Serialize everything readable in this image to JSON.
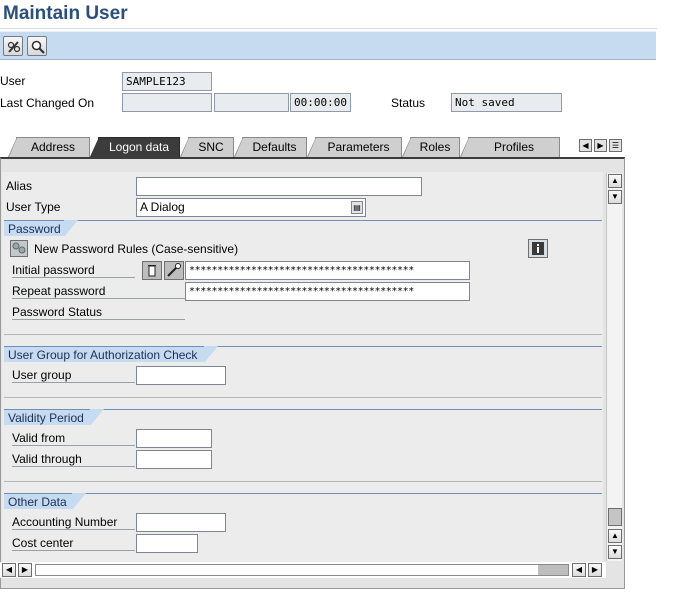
{
  "app": {
    "title": "Maintain User"
  },
  "toolbar": {
    "icons": [
      "pencil-glasses-icon",
      "magnifier-icon"
    ]
  },
  "header": {
    "user_label": "User",
    "user_value": "SAMPLE123",
    "last_changed_label": "Last Changed On",
    "last_changed_by": "",
    "last_changed_date": "",
    "last_changed_time": "00:00:00",
    "status_label": "Status",
    "status_value": "Not saved"
  },
  "tabs": [
    {
      "label": "Address",
      "active": false
    },
    {
      "label": "Logon data",
      "active": true
    },
    {
      "label": "SNC",
      "active": false
    },
    {
      "label": "Defaults",
      "active": false
    },
    {
      "label": "Parameters",
      "active": false
    },
    {
      "label": "Roles",
      "active": false
    },
    {
      "label": "Profiles",
      "active": false
    }
  ],
  "form": {
    "alias_label": "Alias",
    "alias_value": "",
    "user_type_label": "User Type",
    "user_type_value": "A Dialog",
    "password": {
      "group_title": "Password",
      "rules_text": "New Password Rules (Case-sensitive)",
      "initial_label": "Initial password",
      "initial_value": "****************************************",
      "repeat_label": "Repeat password",
      "repeat_value": "****************************************",
      "status_label": "Password Status"
    },
    "user_group": {
      "group_title": "User Group for Authorization Check",
      "label": "User group",
      "value": ""
    },
    "validity": {
      "group_title": "Validity Period",
      "from_label": "Valid from",
      "from_value": "",
      "through_label": "Valid through",
      "through_value": ""
    },
    "other": {
      "group_title": "Other Data",
      "accounting_label": "Accounting Number",
      "accounting_value": "",
      "cost_center_label": "Cost center",
      "cost_center_value": ""
    }
  },
  "colors": {
    "title": "#2a4f7f",
    "toolbar": "#c6daf0",
    "active_tab": "#3c3c3c",
    "group_header": "#c6daf0"
  }
}
